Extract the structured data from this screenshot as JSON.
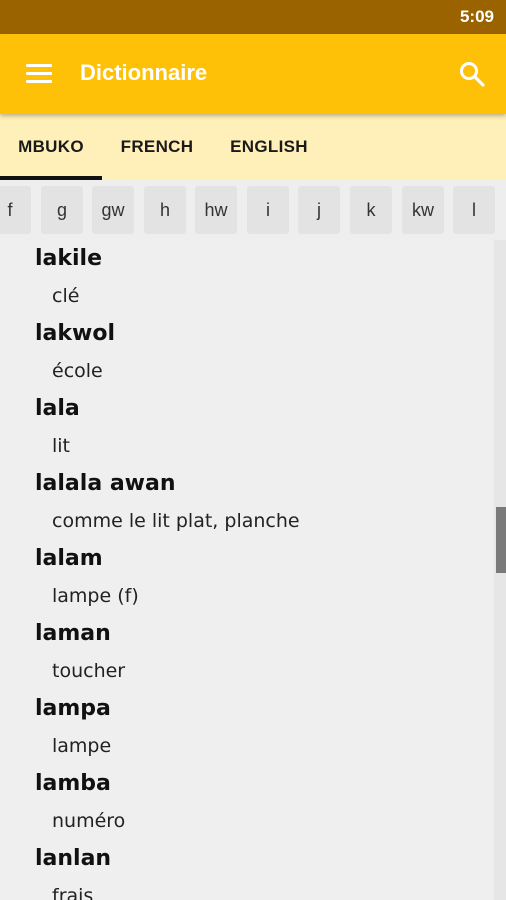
{
  "status_bar": {
    "time": "5:09"
  },
  "app_bar": {
    "title": "Dictionnaire",
    "menu_icon": "hamburger-menu-icon",
    "search_icon": "search-icon"
  },
  "tabs": [
    {
      "label": "MBUKO",
      "active": true
    },
    {
      "label": "FRENCH",
      "active": false
    },
    {
      "label": "ENGLISH",
      "active": false
    }
  ],
  "letters": [
    "f",
    "g",
    "gw",
    "h",
    "hw",
    "i",
    "j",
    "k",
    "kw",
    "l"
  ],
  "entries": [
    {
      "word": "lakile",
      "definition": "clé"
    },
    {
      "word": "lakwol",
      "definition": "école"
    },
    {
      "word": "lala",
      "definition": "lit"
    },
    {
      "word": "lalala awan",
      "definition": "comme le lit plat, planche"
    },
    {
      "word": "lalam",
      "definition": "lampe (f)"
    },
    {
      "word": "laman",
      "definition": "toucher"
    },
    {
      "word": "lampa",
      "definition": "lampe"
    },
    {
      "word": "lamba",
      "definition": "numéro"
    },
    {
      "word": "lanlan",
      "definition": "frais"
    }
  ],
  "colors": {
    "primary": "#ffc107",
    "status_bar": "#9a6300",
    "tab_bar": "#ffefb8"
  }
}
